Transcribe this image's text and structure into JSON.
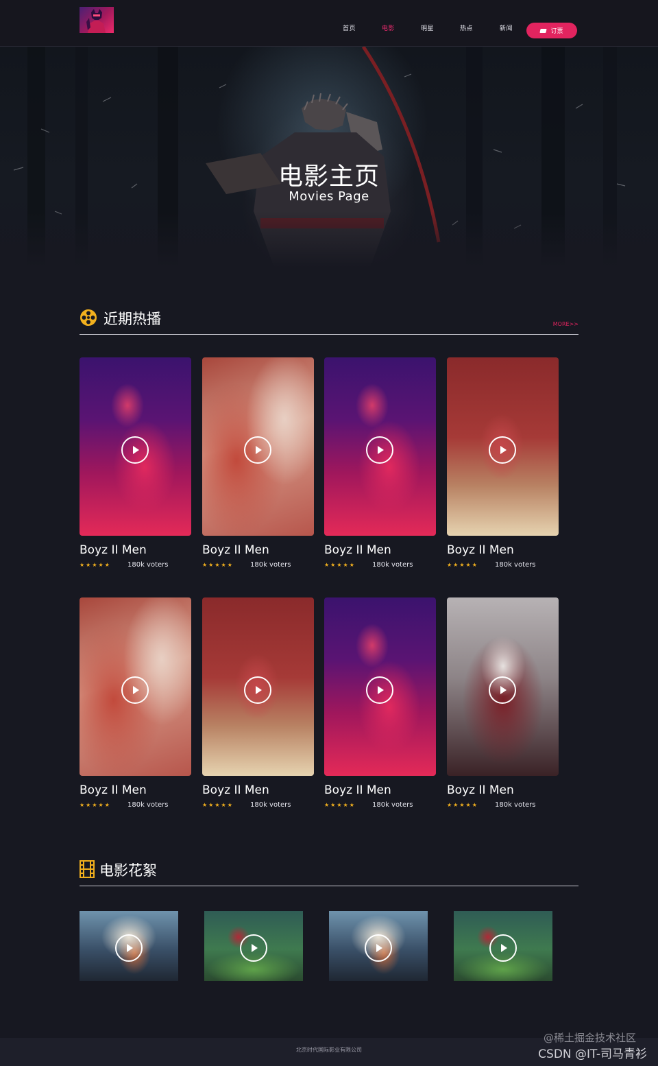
{
  "header": {
    "nav": [
      {
        "label": "首页",
        "active": false
      },
      {
        "label": "电影",
        "active": true
      },
      {
        "label": "明星",
        "active": false
      },
      {
        "label": "热点",
        "active": false
      },
      {
        "label": "新闻",
        "active": false
      }
    ],
    "subscribe_label": "订票",
    "subscribe_icon": "ticket-flag-icon"
  },
  "hero": {
    "title": "电影主页",
    "subtitle": "Movies Page"
  },
  "recent": {
    "title": "近期热播",
    "icon": "film-reel-icon",
    "more_label": "MORE>>",
    "cards": [
      {
        "title": "Boyz II Men",
        "stars": "★★★★★",
        "voters": "180k voters"
      },
      {
        "title": "Boyz II Men",
        "stars": "★★★★★",
        "voters": "180k voters"
      },
      {
        "title": "Boyz II Men",
        "stars": "★★★★★",
        "voters": "180k voters"
      },
      {
        "title": "Boyz II Men",
        "stars": "★★★★★",
        "voters": "180k voters"
      },
      {
        "title": "Boyz II Men",
        "stars": "★★★★★",
        "voters": "180k voters"
      },
      {
        "title": "Boyz II Men",
        "stars": "★★★★★",
        "voters": "180k voters"
      },
      {
        "title": "Boyz II Men",
        "stars": "★★★★★",
        "voters": "180k voters"
      },
      {
        "title": "Boyz II Men",
        "stars": "★★★★★",
        "voters": "180k voters"
      }
    ]
  },
  "clips": {
    "title": "电影花絮",
    "icon": "film-strip-icon"
  },
  "footer": {
    "text": "北京时代国际影业有限公司"
  },
  "watermarks": {
    "line1": "@稀土掘金技术社区",
    "line2": "CSDN @IT-司马青衫"
  },
  "colors": {
    "background": "#171821",
    "accent": "#e2245f",
    "star": "#f2b01e"
  }
}
